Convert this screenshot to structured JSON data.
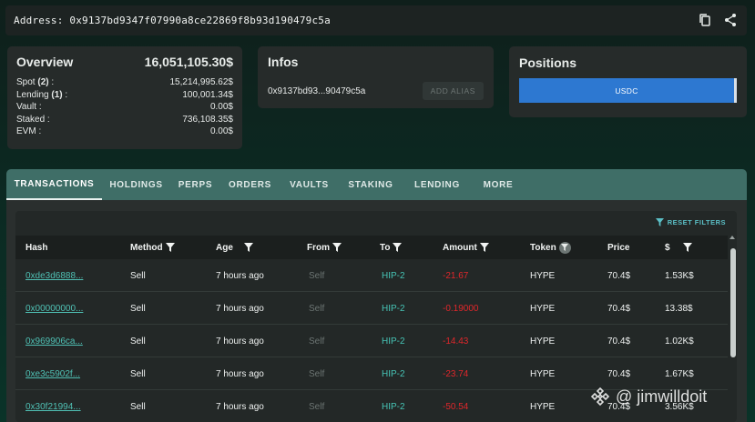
{
  "address_bar": {
    "label": "Address: 0x9137bd9347f07990a8ce22869f8b93d190479c5a",
    "copy_icon": "copy-icon",
    "share_icon": "share-icon"
  },
  "overview": {
    "title": "Overview",
    "total": "16,051,105.30$",
    "rows": [
      {
        "label_a": "Spot ",
        "label_b": "(2)",
        "label_c": " :",
        "value": "15,214,995.62$"
      },
      {
        "label_a": "Lending ",
        "label_b": "(1)",
        "label_c": " :",
        "value": "100,001.34$"
      },
      {
        "label_a": "Vault :",
        "label_b": "",
        "label_c": "",
        "value": "0.00$"
      },
      {
        "label_a": "Staked :",
        "label_b": "",
        "label_c": "",
        "value": "736,108.35$"
      },
      {
        "label_a": "EVM :",
        "label_b": "",
        "label_c": "",
        "value": "0.00$"
      }
    ]
  },
  "infos": {
    "title": "Infos",
    "short_address": "0x9137bd93...90479c5a",
    "alias_button": "ADD ALIAS"
  },
  "positions": {
    "title": "Positions",
    "bar_label": "USDC",
    "bar_color": "#2d78d1"
  },
  "tabs": [
    {
      "label": "TRANSACTIONS",
      "active": true
    },
    {
      "label": "HOLDINGS",
      "active": false
    },
    {
      "label": "PERPS",
      "active": false
    },
    {
      "label": "ORDERS",
      "active": false
    },
    {
      "label": "VAULTS",
      "active": false
    },
    {
      "label": "STAKING",
      "active": false
    },
    {
      "label": "LENDING",
      "active": false
    },
    {
      "label": "MORE",
      "active": false
    }
  ],
  "table": {
    "reset_filters": "RESET FILTERS",
    "columns": [
      "Hash",
      "Method",
      "Age",
      "From",
      "To",
      "Amount",
      "Token",
      "Price",
      "$"
    ],
    "rows": [
      {
        "hash": "0xde3d6888...",
        "method": "Sell",
        "age": "7 hours ago",
        "from": "Self",
        "to": "HIP-2",
        "amount": "-21.67",
        "token": "HYPE",
        "price": "70.4$",
        "usd": "1.53K$"
      },
      {
        "hash": "0x00000000...",
        "method": "Sell",
        "age": "7 hours ago",
        "from": "Self",
        "to": "HIP-2",
        "amount": "-0.19000",
        "token": "HYPE",
        "price": "70.4$",
        "usd": "13.38$"
      },
      {
        "hash": "0x969906ca...",
        "method": "Sell",
        "age": "7 hours ago",
        "from": "Self",
        "to": "HIP-2",
        "amount": "-14.43",
        "token": "HYPE",
        "price": "70.4$",
        "usd": "1.02K$"
      },
      {
        "hash": "0xe3c5902f...",
        "method": "Sell",
        "age": "7 hours ago",
        "from": "Self",
        "to": "HIP-2",
        "amount": "-23.74",
        "token": "HYPE",
        "price": "70.4$",
        "usd": "1.67K$"
      },
      {
        "hash": "0x30f21994...",
        "method": "Sell",
        "age": "7 hours ago",
        "from": "Self",
        "to": "HIP-2",
        "amount": "-50.54",
        "token": "HYPE",
        "price": "70.4$",
        "usd": "3.56K$"
      }
    ]
  },
  "watermark": "@ jimwilldoit",
  "colors": {
    "accent": "#4fc0b4",
    "negative": "#e0272b",
    "tab_bar": "#3f6e67"
  }
}
